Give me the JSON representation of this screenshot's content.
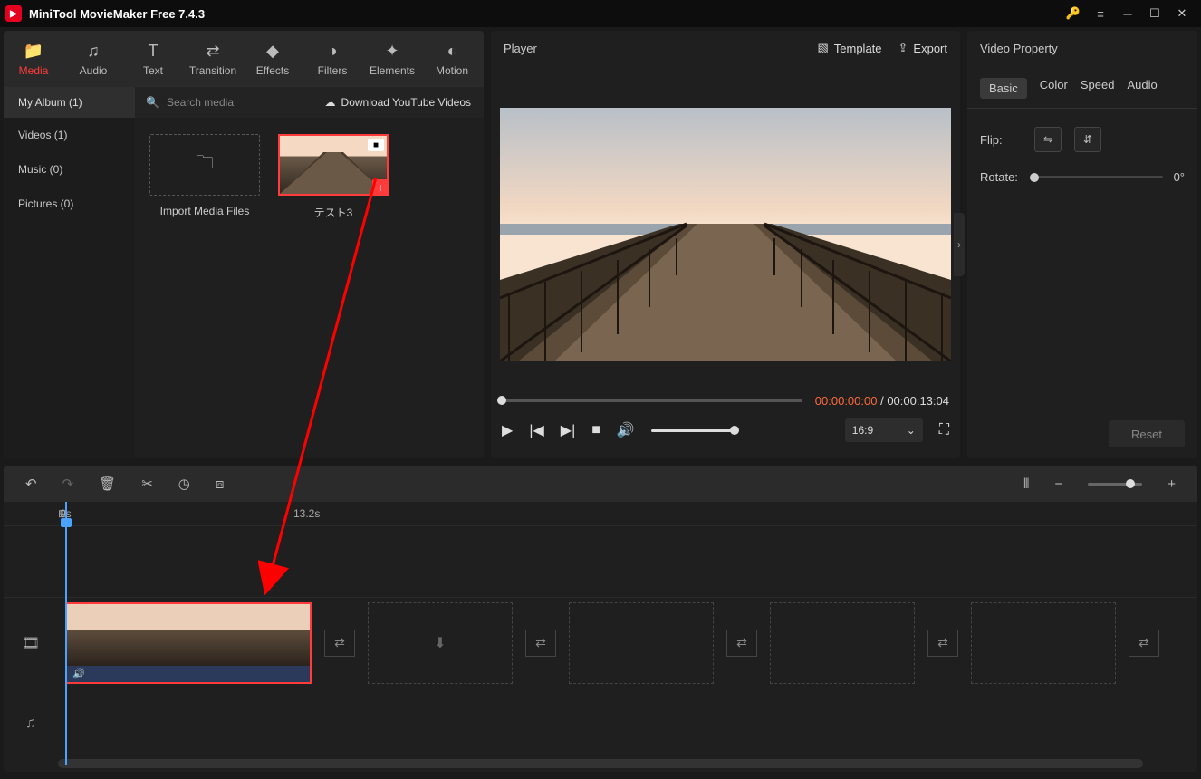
{
  "titlebar": {
    "title": "MiniTool MovieMaker Free 7.4.3"
  },
  "tabs": {
    "media": "Media",
    "audio": "Audio",
    "text": "Text",
    "transition": "Transition",
    "effects": "Effects",
    "filters": "Filters",
    "elements": "Elements",
    "motion": "Motion"
  },
  "album": {
    "myalbum": "My Album (1)",
    "search_placeholder": "Search media",
    "download": "Download YouTube Videos"
  },
  "sidebar": {
    "videos": "Videos (1)",
    "music": "Music (0)",
    "pictures": "Pictures (0)"
  },
  "media": {
    "import_label": "Import Media Files",
    "clip1_label": "テスト3"
  },
  "player": {
    "title": "Player",
    "template": "Template",
    "export": "Export",
    "current": "00:00:00:00",
    "sep": " / ",
    "duration": "00:00:13:04",
    "aspect": "16:9"
  },
  "props": {
    "title": "Video Property",
    "basic": "Basic",
    "color": "Color",
    "speed": "Speed",
    "audio": "Audio",
    "flip": "Flip:",
    "rotate": "Rotate:",
    "rotate_val": "0°",
    "reset": "Reset"
  },
  "ruler": {
    "zero": "0s",
    "mark": "13.2s"
  }
}
